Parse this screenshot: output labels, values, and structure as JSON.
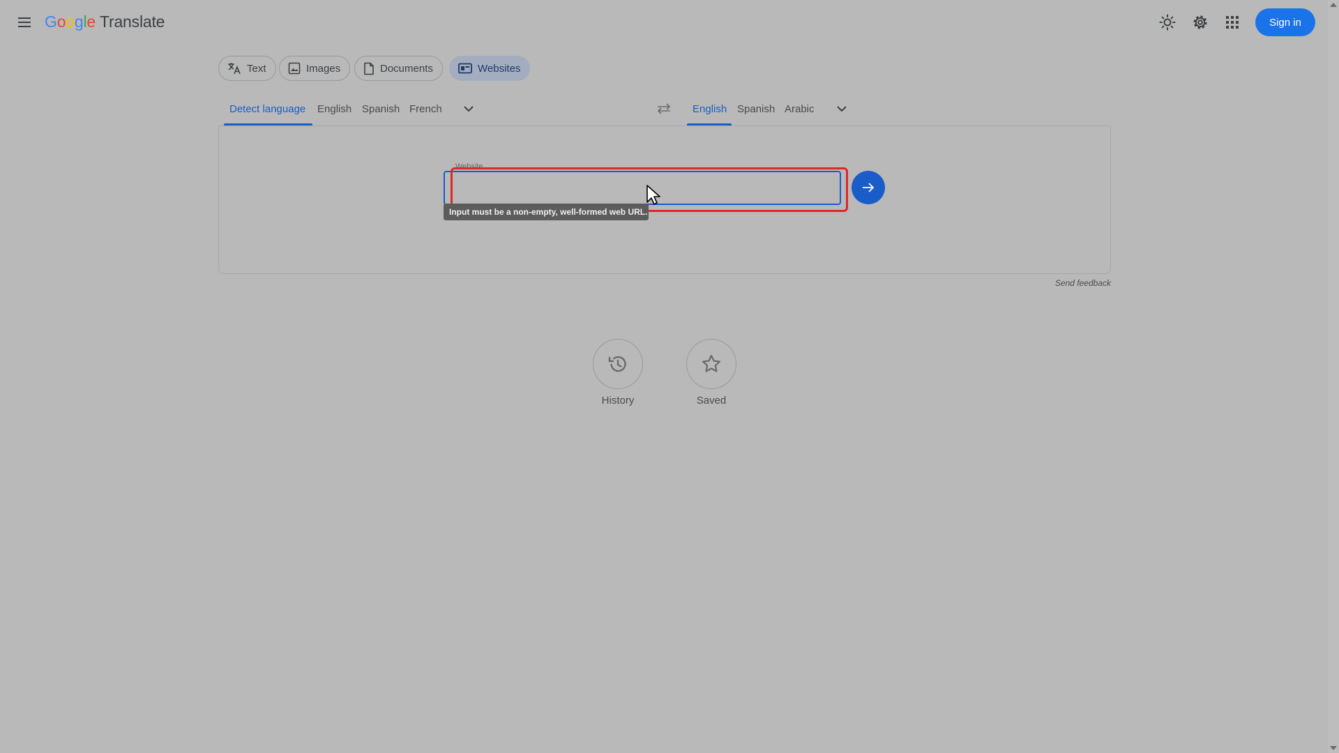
{
  "header": {
    "logo": {
      "letters": [
        "G",
        "o",
        "o",
        "g",
        "l",
        "e"
      ],
      "product": "Translate"
    },
    "signin_label": "Sign in",
    "icons": [
      "menu-icon",
      "theme-sun-icon",
      "settings-gear-icon",
      "apps-grid-icon"
    ]
  },
  "modes": [
    {
      "label": "Text",
      "icon": "translate-icon",
      "active": false
    },
    {
      "label": "Images",
      "icon": "image-icon",
      "active": false
    },
    {
      "label": "Documents",
      "icon": "document-icon",
      "active": false
    },
    {
      "label": "Websites",
      "icon": "website-icon",
      "active": true
    }
  ],
  "source_languages": {
    "items": [
      "Detect language",
      "English",
      "Spanish",
      "French"
    ],
    "selected": "Detect language"
  },
  "target_languages": {
    "items": [
      "English",
      "Spanish",
      "Arabic"
    ],
    "selected": "English"
  },
  "website_input": {
    "label": "Website",
    "value": "",
    "error_tooltip": "Input must be a non-empty, well-formed web URL."
  },
  "feedback_label": "Send feedback",
  "bottom_actions": {
    "history_label": "History",
    "saved_label": "Saved"
  },
  "colors": {
    "accent": "#1a5cc8",
    "background": "#b9b9b9",
    "highlight": "#e0262b"
  }
}
